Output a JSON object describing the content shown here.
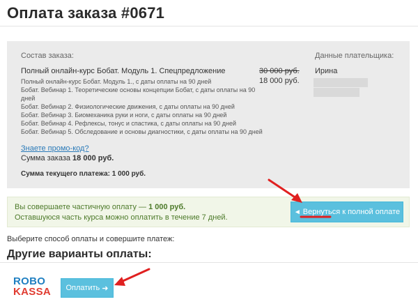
{
  "page": {
    "title": "Оплата заказа #0671"
  },
  "order": {
    "heading": "Состав заказа:",
    "main_item": "Полный онлайн-курс Бобат. Модуль 1. Спецпредложение",
    "sub_items": [
      "Полный онлайн-курс Бобат. Модуль 1., с даты оплаты на 90 дней",
      "Бобат. Вебинар 1. Теоретические основы концепции Бобат, с даты оплаты на 90",
      "дней",
      "Бобат. Вебинар 2. Физиологические движения, с даты оплаты на 90 дней",
      "Бобат. Вебинар 3. Биомеханика руки и ноги, с даты оплаты на 90 дней",
      "Бобат. Вебинар 4. Рефлексы, тонус и спастика, с даты оплаты на 90 дней",
      "Бобат. Вебинар 5. Обследование и основы диагностики, с даты оплаты на 90 дней"
    ],
    "price_old": "30 000 руб.",
    "price_new": "18 000 руб.",
    "promo_link": "Знаете промо-код?",
    "total_label": "Сумма заказа ",
    "total_value": "18 000 руб.",
    "current_payment": "Сумма текущего платежа: 1 000 руб."
  },
  "payer": {
    "heading": "Данные плательщика:",
    "name": "Ирина"
  },
  "partial": {
    "line1_prefix": "Вы совершаете частичную оплату — ",
    "line1_amount": "1 000 руб.",
    "line2": "Оставшуюся часть курса можно оплатить в течение 7 дней.",
    "return_button": "Вернуться к полной оплате",
    "return_icon": "arrow-left-icon"
  },
  "payment": {
    "choose_text": "Выберите способ оплаты и совершите платеж:",
    "other_heading": "Другие варианты оплаты:",
    "logo_top": "ROBO",
    "logo_bottom": "KASSA",
    "pay_button": "Оплатить",
    "pay_icon": "arrow-right-icon"
  },
  "colors": {
    "accent": "#5bc0de",
    "annotation": "#e02020",
    "logo_blue": "#1f7fc1",
    "logo_red": "#e03c31"
  }
}
